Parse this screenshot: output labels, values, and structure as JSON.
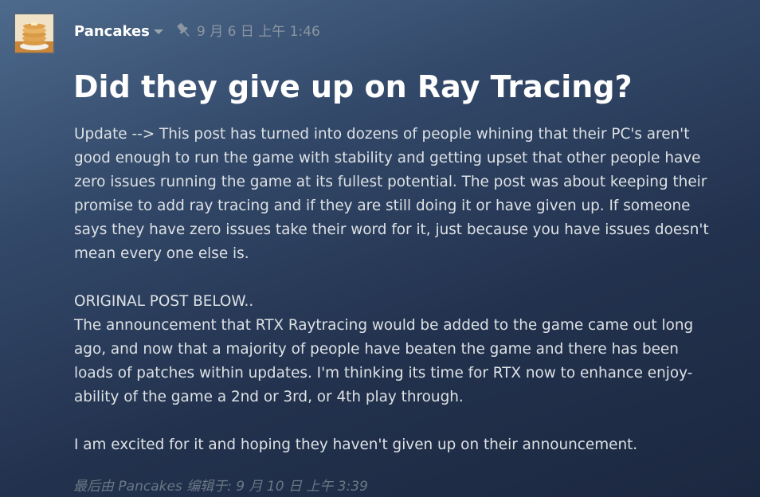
{
  "post": {
    "author": "Pancakes",
    "timestamp": "9 月 6 日 上午 1:46",
    "title": "Did they give up on Ray Tracing?",
    "lines": [
      "Update --> This post has turned into dozens of people whining that their PC's aren't",
      "good enough to run the game with stability and getting upset that other people have",
      "zero issues running the game at its fullest potential. The post was about keeping their",
      "promise to add ray tracing and if they are still doing it or have given up. If someone",
      "says they have zero issues take their word for it, just because you have issues doesn't",
      "mean every one else is.",
      "",
      "ORIGINAL POST BELOW..",
      "The announcement that RTX Raytracing would be added to the game came out long",
      "ago, and now that a majority of people have beaten the game and there has been",
      "loads of patches within updates. I'm thinking its time for RTX now to enhance enjoy-",
      "ability of the game a 2nd or 3rd, or 4th play through.",
      "",
      "I am excited for it and hoping they haven't given up on their announcement."
    ],
    "edited_note": "最后由 Pancakes 编辑于: 9 月 10 日 上午 3:39"
  },
  "icons": {
    "avatar": "pancakes-avatar",
    "author_menu": "chevron-down-icon",
    "pinned": "pin-icon"
  },
  "colors": {
    "author": "#ffffff",
    "title": "#ffffff",
    "body_text": "#dde1e4",
    "meta_text": "#8b96a1",
    "edited_text": "#6b7785"
  }
}
